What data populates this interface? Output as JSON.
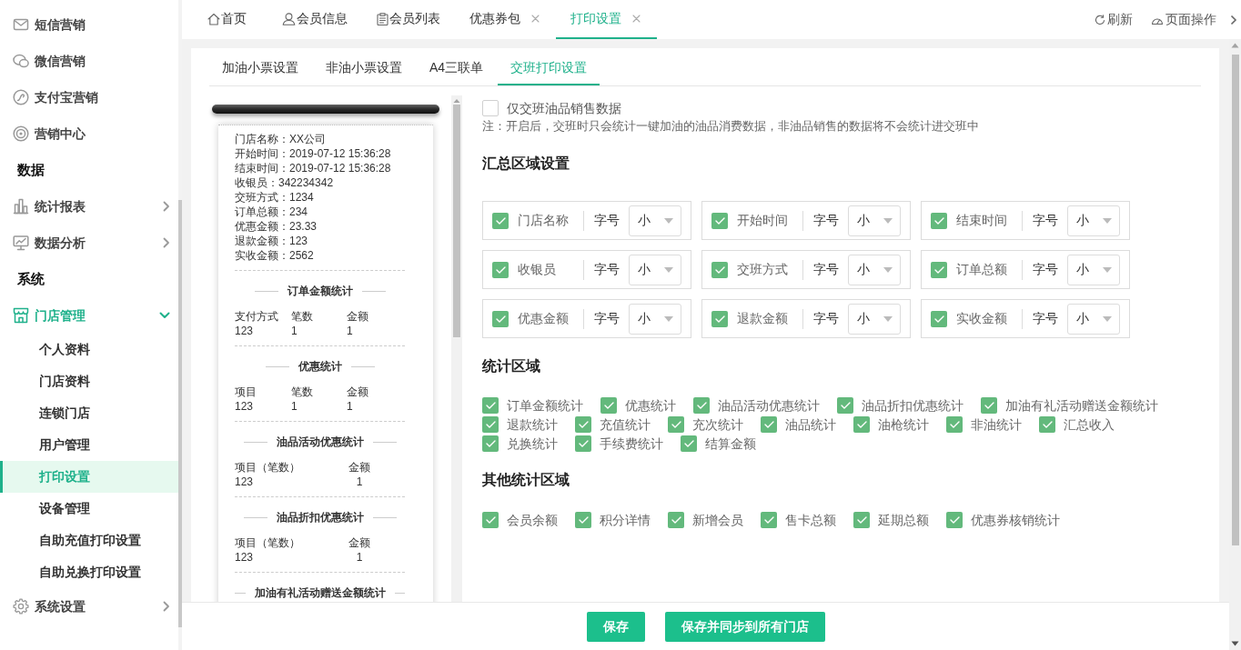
{
  "sidebar": {
    "items": [
      {
        "kind": "link",
        "label": "短信营销"
      },
      {
        "kind": "link",
        "label": "微信营销"
      },
      {
        "kind": "link",
        "label": "支付宝营销"
      },
      {
        "kind": "link",
        "label": "营销中心"
      },
      {
        "kind": "header",
        "label": "数据"
      },
      {
        "kind": "group",
        "label": "统计报表",
        "expanded": false
      },
      {
        "kind": "group",
        "label": "数据分析",
        "expanded": false
      },
      {
        "kind": "header",
        "label": "系统"
      },
      {
        "kind": "group",
        "label": "门店管理",
        "expanded": true,
        "children": [
          {
            "label": "个人资料",
            "selected": false
          },
          {
            "label": "门店资料",
            "selected": false
          },
          {
            "label": "连锁门店",
            "selected": false
          },
          {
            "label": "用户管理",
            "selected": false
          },
          {
            "label": "打印设置",
            "selected": true
          },
          {
            "label": "设备管理",
            "selected": false
          },
          {
            "label": "自助充值打印设置",
            "selected": false
          },
          {
            "label": "自助兑换打印设置",
            "selected": false
          }
        ]
      },
      {
        "kind": "group",
        "label": "系统设置",
        "expanded": false
      }
    ]
  },
  "tabs": [
    {
      "label": "首页",
      "selected": false,
      "closable": false
    },
    {
      "label": "会员信息",
      "selected": false,
      "closable": false
    },
    {
      "label": "会员列表",
      "selected": false,
      "closable": false
    },
    {
      "label": "优惠券包",
      "selected": false,
      "closable": true
    },
    {
      "label": "打印设置",
      "selected": true,
      "closable": true
    }
  ],
  "toolbar": [
    {
      "label": "刷新"
    },
    {
      "label": "页面操作"
    }
  ],
  "settings_tabs": [
    {
      "label": "加油小票设置",
      "selected": false
    },
    {
      "label": "非油小票设置",
      "selected": false
    },
    {
      "label": "A4三联单",
      "selected": false
    },
    {
      "label": "交班打印设置",
      "selected": true
    }
  ],
  "receipt": {
    "lines": [
      "门店名称：XX公司",
      "开始时间：2019-07-12 15:36:28",
      "结束时间：2019-07-12 15:36:28",
      "收银员：342234342",
      "交班方式：1234",
      "订单总额：234",
      "优惠金额：23.33",
      "退款金额：123",
      "实收金额：2562"
    ],
    "sections": [
      {
        "title": "订单金额统计",
        "columns": [
          "支付方式",
          "笔数",
          "金额"
        ],
        "rows": [
          [
            "123",
            "1",
            "1"
          ]
        ]
      },
      {
        "title": "优惠统计",
        "columns": [
          "项目",
          "笔数",
          "金额"
        ],
        "rows": [
          [
            "123",
            "1",
            "1"
          ]
        ]
      },
      {
        "title": "油品活动优惠统计",
        "columns": [
          "项目（笔数）",
          "金额"
        ],
        "rows": [
          [
            "123",
            "1"
          ]
        ]
      },
      {
        "title": "油品折扣优惠统计",
        "columns": [
          "项目（笔数）",
          "金额"
        ],
        "rows": [
          [
            "123",
            "1"
          ]
        ]
      },
      {
        "title": "加油有礼活动赠送金额统计"
      }
    ]
  },
  "only_oil_sales": {
    "label": "仅交班油品销售数据",
    "checked": false
  },
  "note": "注：开启后，交班时只会统计一键加油的油品消费数据，非油品销售的数据将不会统计进交班中",
  "summary_area": {
    "title": "汇总区域设置",
    "fields": [
      {
        "label": "门店名称",
        "checked": true,
        "size_label": "字号",
        "size": "小"
      },
      {
        "label": "开始时间",
        "checked": true,
        "size_label": "字号",
        "size": "小"
      },
      {
        "label": "结束时间",
        "checked": true,
        "size_label": "字号",
        "size": "小"
      },
      {
        "label": "收银员",
        "checked": true,
        "size_label": "字号",
        "size": "小"
      },
      {
        "label": "交班方式",
        "checked": true,
        "size_label": "字号",
        "size": "小"
      },
      {
        "label": "订单总额",
        "checked": true,
        "size_label": "字号",
        "size": "小"
      },
      {
        "label": "优惠金额",
        "checked": true,
        "size_label": "字号",
        "size": "小"
      },
      {
        "label": "退款金额",
        "checked": true,
        "size_label": "字号",
        "size": "小"
      },
      {
        "label": "实收金额",
        "checked": true,
        "size_label": "字号",
        "size": "小"
      }
    ]
  },
  "stats_area": {
    "title": "统计区域",
    "options": [
      {
        "label": "订单金额统计",
        "checked": true
      },
      {
        "label": "优惠统计",
        "checked": true
      },
      {
        "label": "油品活动优惠统计",
        "checked": true
      },
      {
        "label": "油品折扣优惠统计",
        "checked": true
      },
      {
        "label": "加油有礼活动赠送金额统计",
        "checked": true
      },
      {
        "label": "退款统计",
        "checked": true
      },
      {
        "label": "充值统计",
        "checked": true
      },
      {
        "label": "充次统计",
        "checked": true
      },
      {
        "label": "油品统计",
        "checked": true
      },
      {
        "label": "油枪统计",
        "checked": true
      },
      {
        "label": "非油统计",
        "checked": true
      },
      {
        "label": "汇总收入",
        "checked": true
      },
      {
        "label": "兑换统计",
        "checked": true
      },
      {
        "label": "手续费统计",
        "checked": true
      },
      {
        "label": "结算金额",
        "checked": true
      }
    ]
  },
  "other_stats_area": {
    "title": "其他统计区域",
    "options": [
      {
        "label": "会员余额",
        "checked": true
      },
      {
        "label": "积分详情",
        "checked": true
      },
      {
        "label": "新增会员",
        "checked": true
      },
      {
        "label": "售卡总额",
        "checked": true
      },
      {
        "label": "延期总额",
        "checked": true
      },
      {
        "label": "优惠券核销统计",
        "checked": true
      }
    ]
  },
  "buttons": [
    {
      "label": "保存"
    },
    {
      "label": "保存并同步到所有门店"
    }
  ]
}
